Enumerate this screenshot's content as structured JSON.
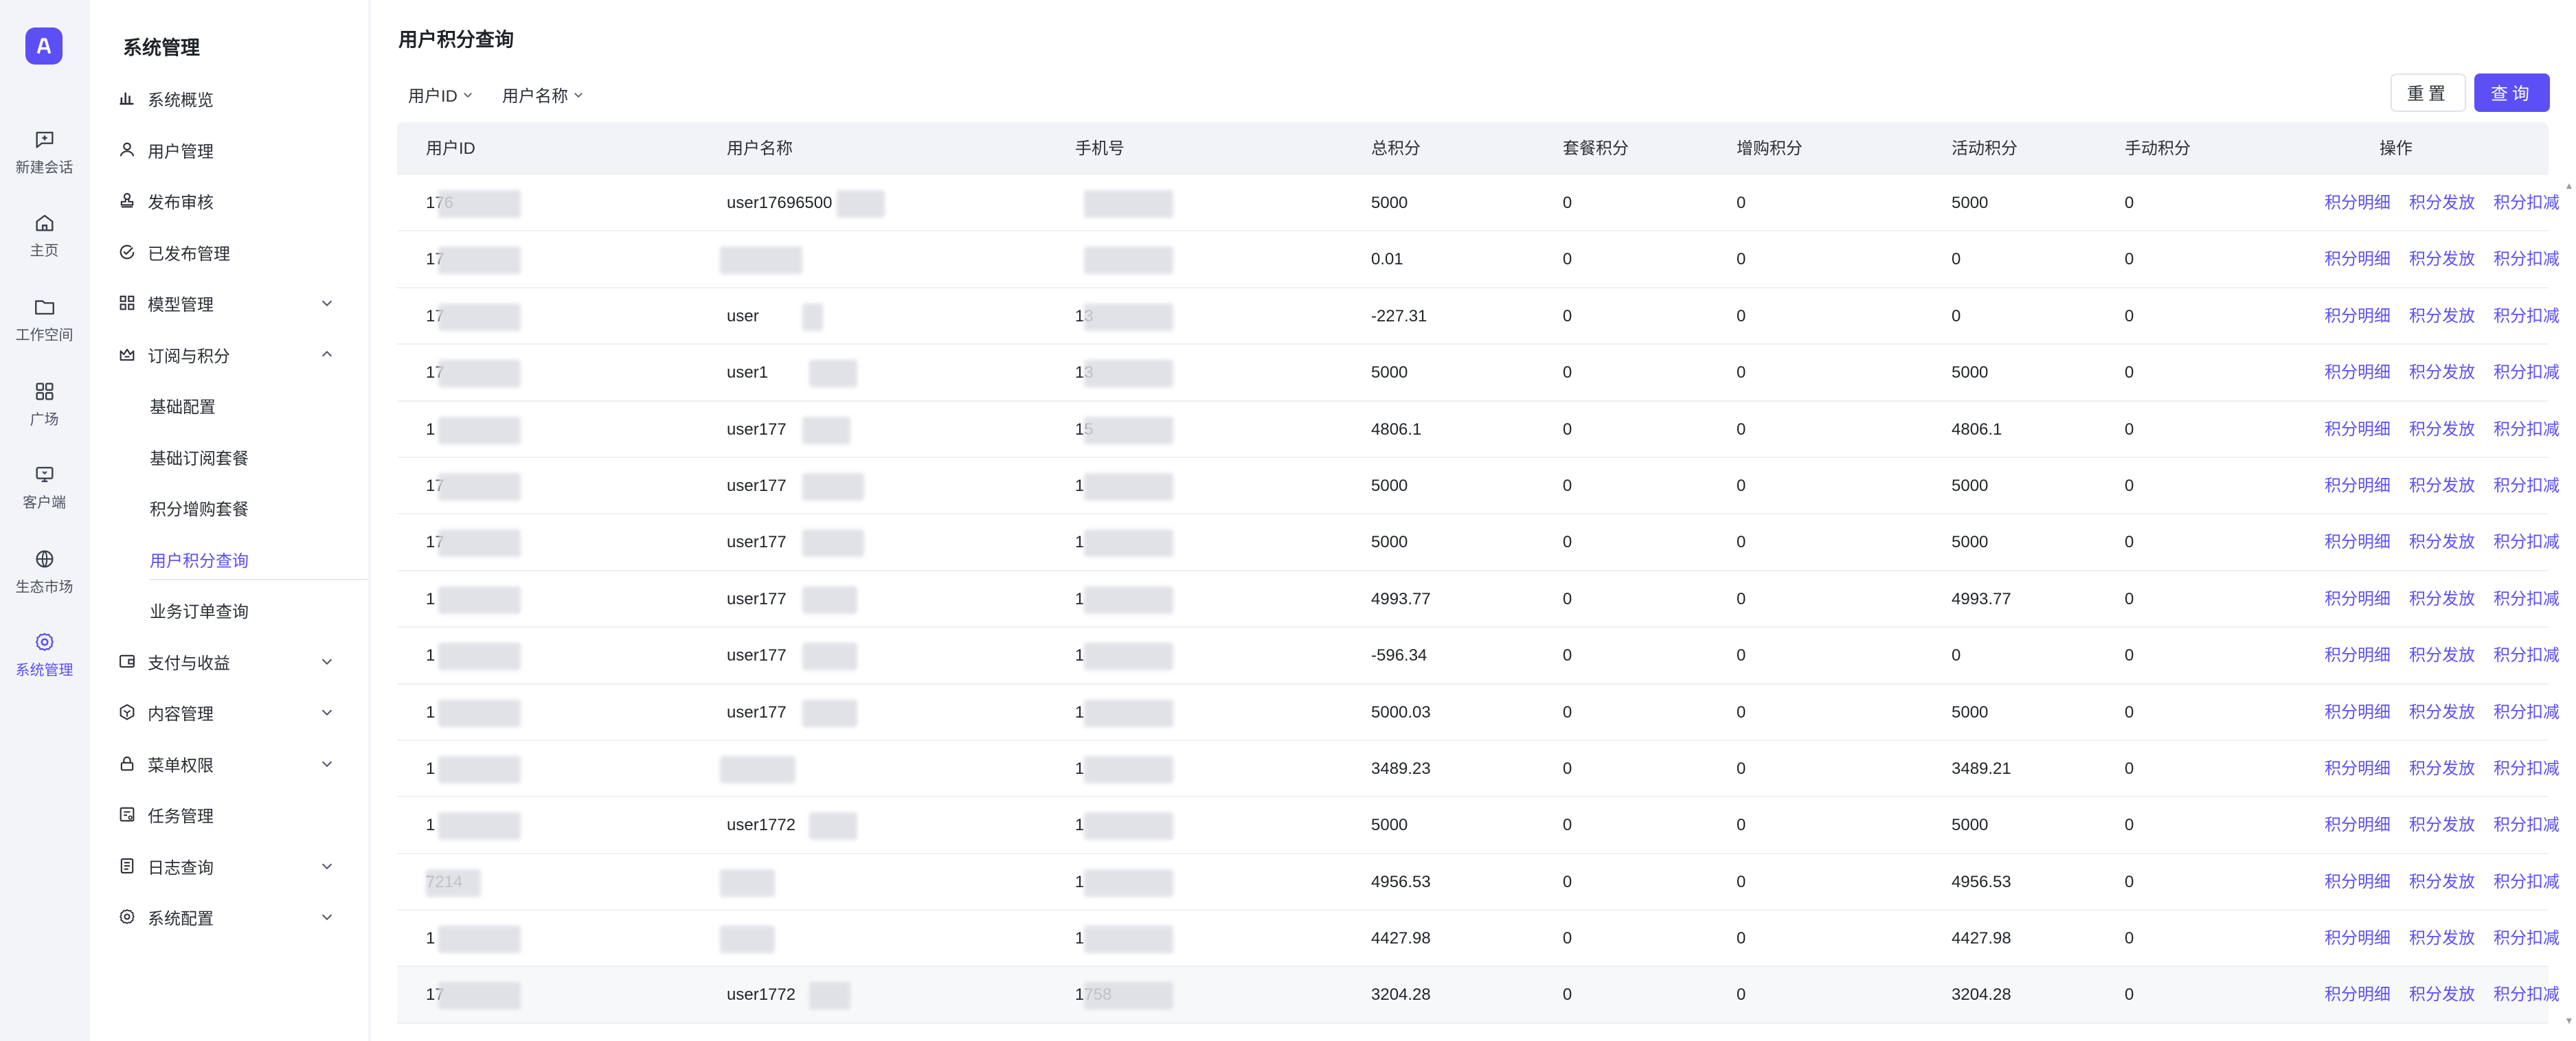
{
  "rail": {
    "items": [
      {
        "label": "新建会话",
        "icon": "new-chat-icon"
      },
      {
        "label": "主页",
        "icon": "home-icon"
      },
      {
        "label": "工作空间",
        "icon": "folder-icon"
      },
      {
        "label": "广场",
        "icon": "grid-icon"
      },
      {
        "label": "客户端",
        "icon": "monitor-icon"
      },
      {
        "label": "生态市场",
        "icon": "globe-icon"
      },
      {
        "label": "系统管理",
        "icon": "settings-icon"
      }
    ]
  },
  "sidebar": {
    "title": "系统管理",
    "items": [
      {
        "label": "系统概览",
        "icon": "bar-chart-icon"
      },
      {
        "label": "用户管理",
        "icon": "user-icon"
      },
      {
        "label": "发布审核",
        "icon": "stamp-icon"
      },
      {
        "label": "已发布管理",
        "icon": "check-circle-icon"
      },
      {
        "label": "模型管理",
        "icon": "blocks-icon",
        "expandable": true
      },
      {
        "label": "订阅与积分",
        "icon": "crown-icon",
        "expanded": true
      },
      {
        "label": "基础配置"
      },
      {
        "label": "基础订阅套餐"
      },
      {
        "label": "积分增购套餐"
      },
      {
        "label": "用户积分查询",
        "selected": true
      },
      {
        "label": "业务订单查询"
      },
      {
        "label": "支付与收益",
        "icon": "wallet-icon",
        "expandable": true
      },
      {
        "label": "内容管理",
        "icon": "hexagon-icon",
        "expandable": true
      },
      {
        "label": "菜单权限",
        "icon": "lock-icon",
        "expandable": true
      },
      {
        "label": "任务管理",
        "icon": "task-icon"
      },
      {
        "label": "日志查询",
        "icon": "log-icon",
        "expandable": true
      },
      {
        "label": "系统配置",
        "icon": "gear-icon",
        "expandable": true
      }
    ]
  },
  "main": {
    "title": "用户积分查询",
    "filters": [
      "用户ID",
      "用户名称"
    ],
    "reset_label": "重置",
    "query_label": "查询",
    "columns": [
      "用户ID",
      "用户名称",
      "手机号",
      "总积分",
      "套餐积分",
      "增购积分",
      "活动积分",
      "手动积分",
      "操作"
    ],
    "actions": [
      "积分明细",
      "积分发放",
      "积分扣减"
    ],
    "rows": [
      {
        "id": "176",
        "name": "user17696500",
        "phone": "",
        "total": "5000",
        "plan": "0",
        "bonus": "0",
        "activity": "5000",
        "manual": "0"
      },
      {
        "id": "17",
        "name": "",
        "phone": "",
        "total": "0.01",
        "plan": "0",
        "bonus": "0",
        "activity": "0",
        "manual": "0"
      },
      {
        "id": "17",
        "name": "user",
        "phone": "13",
        "total": "-227.31",
        "plan": "0",
        "bonus": "0",
        "activity": "0",
        "manual": "0"
      },
      {
        "id": "17",
        "name": "user1",
        "phone": "13",
        "total": "5000",
        "plan": "0",
        "bonus": "0",
        "activity": "5000",
        "manual": "0"
      },
      {
        "id": "1",
        "name": "user177",
        "phone": "15",
        "total": "4806.1",
        "plan": "0",
        "bonus": "0",
        "activity": "4806.1",
        "manual": "0"
      },
      {
        "id": "17",
        "name": "user177",
        "phone": "1",
        "total": "5000",
        "plan": "0",
        "bonus": "0",
        "activity": "5000",
        "manual": "0"
      },
      {
        "id": "17",
        "name": "user177",
        "phone": "1",
        "total": "5000",
        "plan": "0",
        "bonus": "0",
        "activity": "5000",
        "manual": "0"
      },
      {
        "id": "1",
        "name": "user177",
        "phone": "1",
        "total": "4993.77",
        "plan": "0",
        "bonus": "0",
        "activity": "4993.77",
        "manual": "0"
      },
      {
        "id": "1",
        "name": "user177",
        "phone": "1",
        "total": "-596.34",
        "plan": "0",
        "bonus": "0",
        "activity": "0",
        "manual": "0"
      },
      {
        "id": "1",
        "name": "user177",
        "phone": "1",
        "total": "5000.03",
        "plan": "0",
        "bonus": "0",
        "activity": "5000",
        "manual": "0"
      },
      {
        "id": "1",
        "name": "",
        "phone": "1",
        "total": "3489.23",
        "plan": "0",
        "bonus": "0",
        "activity": "3489.21",
        "manual": "0"
      },
      {
        "id": "1",
        "name": "user1772",
        "phone": "1",
        "total": "5000",
        "plan": "0",
        "bonus": "0",
        "activity": "5000",
        "manual": "0"
      },
      {
        "id": "7214",
        "name": "",
        "phone": "1",
        "total": "4956.53",
        "plan": "0",
        "bonus": "0",
        "activity": "4956.53",
        "manual": "0"
      },
      {
        "id": "1",
        "name": "",
        "phone": "1",
        "total": "4427.98",
        "plan": "0",
        "bonus": "0",
        "activity": "4427.98",
        "manual": "0"
      },
      {
        "id": "17",
        "name": "user1772",
        "phone": "1758",
        "total": "3204.28",
        "plan": "0",
        "bonus": "0",
        "activity": "3204.28",
        "manual": "0"
      }
    ]
  },
  "colors": {
    "accent": "#5b4ff5",
    "header_bg": "#f2f3f7",
    "rail_bg": "#f3f4f7"
  }
}
